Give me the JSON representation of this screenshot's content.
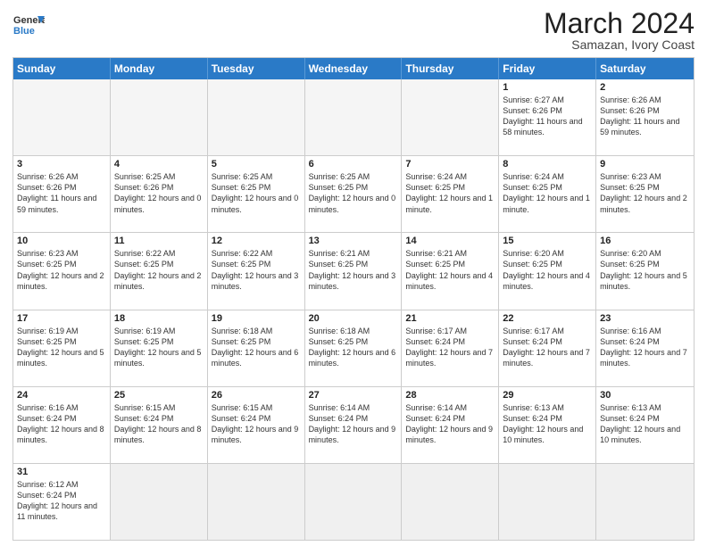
{
  "header": {
    "logo_general": "General",
    "logo_blue": "Blue",
    "month_title": "March 2024",
    "location": "Samazan, Ivory Coast"
  },
  "weekdays": [
    "Sunday",
    "Monday",
    "Tuesday",
    "Wednesday",
    "Thursday",
    "Friday",
    "Saturday"
  ],
  "rows": [
    [
      {
        "day": "",
        "info": ""
      },
      {
        "day": "",
        "info": ""
      },
      {
        "day": "",
        "info": ""
      },
      {
        "day": "",
        "info": ""
      },
      {
        "day": "",
        "info": ""
      },
      {
        "day": "1",
        "info": "Sunrise: 6:27 AM\nSunset: 6:26 PM\nDaylight: 11 hours\nand 58 minutes."
      },
      {
        "day": "2",
        "info": "Sunrise: 6:26 AM\nSunset: 6:26 PM\nDaylight: 11 hours\nand 59 minutes."
      }
    ],
    [
      {
        "day": "3",
        "info": "Sunrise: 6:26 AM\nSunset: 6:26 PM\nDaylight: 11 hours\nand 59 minutes."
      },
      {
        "day": "4",
        "info": "Sunrise: 6:25 AM\nSunset: 6:26 PM\nDaylight: 12 hours\nand 0 minutes."
      },
      {
        "day": "5",
        "info": "Sunrise: 6:25 AM\nSunset: 6:25 PM\nDaylight: 12 hours\nand 0 minutes."
      },
      {
        "day": "6",
        "info": "Sunrise: 6:25 AM\nSunset: 6:25 PM\nDaylight: 12 hours\nand 0 minutes."
      },
      {
        "day": "7",
        "info": "Sunrise: 6:24 AM\nSunset: 6:25 PM\nDaylight: 12 hours\nand 1 minute."
      },
      {
        "day": "8",
        "info": "Sunrise: 6:24 AM\nSunset: 6:25 PM\nDaylight: 12 hours\nand 1 minute."
      },
      {
        "day": "9",
        "info": "Sunrise: 6:23 AM\nSunset: 6:25 PM\nDaylight: 12 hours\nand 2 minutes."
      }
    ],
    [
      {
        "day": "10",
        "info": "Sunrise: 6:23 AM\nSunset: 6:25 PM\nDaylight: 12 hours\nand 2 minutes."
      },
      {
        "day": "11",
        "info": "Sunrise: 6:22 AM\nSunset: 6:25 PM\nDaylight: 12 hours\nand 2 minutes."
      },
      {
        "day": "12",
        "info": "Sunrise: 6:22 AM\nSunset: 6:25 PM\nDaylight: 12 hours\nand 3 minutes."
      },
      {
        "day": "13",
        "info": "Sunrise: 6:21 AM\nSunset: 6:25 PM\nDaylight: 12 hours\nand 3 minutes."
      },
      {
        "day": "14",
        "info": "Sunrise: 6:21 AM\nSunset: 6:25 PM\nDaylight: 12 hours\nand 4 minutes."
      },
      {
        "day": "15",
        "info": "Sunrise: 6:20 AM\nSunset: 6:25 PM\nDaylight: 12 hours\nand 4 minutes."
      },
      {
        "day": "16",
        "info": "Sunrise: 6:20 AM\nSunset: 6:25 PM\nDaylight: 12 hours\nand 5 minutes."
      }
    ],
    [
      {
        "day": "17",
        "info": "Sunrise: 6:19 AM\nSunset: 6:25 PM\nDaylight: 12 hours\nand 5 minutes."
      },
      {
        "day": "18",
        "info": "Sunrise: 6:19 AM\nSunset: 6:25 PM\nDaylight: 12 hours\nand 5 minutes."
      },
      {
        "day": "19",
        "info": "Sunrise: 6:18 AM\nSunset: 6:25 PM\nDaylight: 12 hours\nand 6 minutes."
      },
      {
        "day": "20",
        "info": "Sunrise: 6:18 AM\nSunset: 6:25 PM\nDaylight: 12 hours\nand 6 minutes."
      },
      {
        "day": "21",
        "info": "Sunrise: 6:17 AM\nSunset: 6:24 PM\nDaylight: 12 hours\nand 7 minutes."
      },
      {
        "day": "22",
        "info": "Sunrise: 6:17 AM\nSunset: 6:24 PM\nDaylight: 12 hours\nand 7 minutes."
      },
      {
        "day": "23",
        "info": "Sunrise: 6:16 AM\nSunset: 6:24 PM\nDaylight: 12 hours\nand 7 minutes."
      }
    ],
    [
      {
        "day": "24",
        "info": "Sunrise: 6:16 AM\nSunset: 6:24 PM\nDaylight: 12 hours\nand 8 minutes."
      },
      {
        "day": "25",
        "info": "Sunrise: 6:15 AM\nSunset: 6:24 PM\nDaylight: 12 hours\nand 8 minutes."
      },
      {
        "day": "26",
        "info": "Sunrise: 6:15 AM\nSunset: 6:24 PM\nDaylight: 12 hours\nand 9 minutes."
      },
      {
        "day": "27",
        "info": "Sunrise: 6:14 AM\nSunset: 6:24 PM\nDaylight: 12 hours\nand 9 minutes."
      },
      {
        "day": "28",
        "info": "Sunrise: 6:14 AM\nSunset: 6:24 PM\nDaylight: 12 hours\nand 9 minutes."
      },
      {
        "day": "29",
        "info": "Sunrise: 6:13 AM\nSunset: 6:24 PM\nDaylight: 12 hours\nand 10 minutes."
      },
      {
        "day": "30",
        "info": "Sunrise: 6:13 AM\nSunset: 6:24 PM\nDaylight: 12 hours\nand 10 minutes."
      }
    ],
    [
      {
        "day": "31",
        "info": "Sunrise: 6:12 AM\nSunset: 6:24 PM\nDaylight: 12 hours\nand 11 minutes."
      },
      {
        "day": "",
        "info": ""
      },
      {
        "day": "",
        "info": ""
      },
      {
        "day": "",
        "info": ""
      },
      {
        "day": "",
        "info": ""
      },
      {
        "day": "",
        "info": ""
      },
      {
        "day": "",
        "info": ""
      }
    ]
  ]
}
